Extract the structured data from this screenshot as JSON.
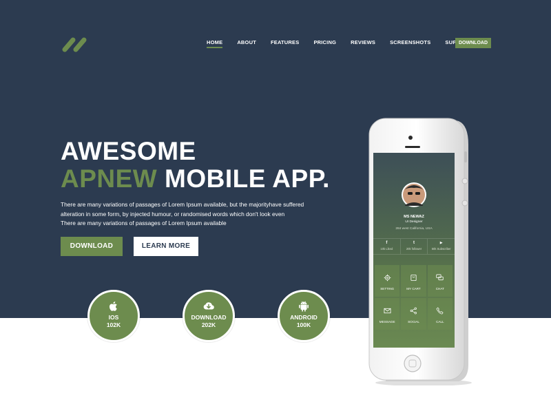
{
  "nav": {
    "items": [
      {
        "label": "HOME",
        "active": true
      },
      {
        "label": "ABOUT"
      },
      {
        "label": "FEATURES"
      },
      {
        "label": "PRICING"
      },
      {
        "label": "REVIEWS"
      },
      {
        "label": "SCREENSHOTS"
      },
      {
        "label": "SUPPORT"
      }
    ],
    "download_label": "DOWNLOAD"
  },
  "hero": {
    "line1": "AWESOME",
    "line2_accent": "APNEW",
    "line2_rest": " MOBILE APP.",
    "desc": [
      "There are many variations of passages of Lorem Ipsum available, but the majorityhave suffered",
      "alteration in some form, by injected humour, or randomised words which don't look even",
      "There are many variations of passages of Lorem Ipsum available"
    ],
    "download_button": "DOWNLOAD",
    "learn_more_button": "LEARN MORE"
  },
  "stats": [
    {
      "label": "IOS",
      "value": "102K",
      "icon": "apple-icon"
    },
    {
      "label": "DOWNLOAD",
      "value": "202K",
      "icon": "cloud-download-icon"
    },
    {
      "label": "ANDROID",
      "value": "100K",
      "icon": "android-icon"
    }
  ],
  "phone": {
    "profile": {
      "name": "MS NEWAZ",
      "role": "UI Designer",
      "location": "284 west California, USA"
    },
    "social": [
      {
        "icon": "facebook-icon",
        "glyph": "f",
        "label": "10k Liked"
      },
      {
        "icon": "twitter-icon",
        "glyph": "t",
        "label": "20k follower"
      },
      {
        "icon": "youtube-icon",
        "glyph": "▶",
        "label": "50k Subscriber"
      }
    ],
    "tiles": [
      {
        "icon": "gear-icon",
        "label": "SETTING"
      },
      {
        "icon": "cart-icon",
        "label": "MY CART"
      },
      {
        "icon": "chat-icon",
        "label": "CHAT"
      },
      {
        "icon": "message-icon",
        "label": "MESSAGE"
      },
      {
        "icon": "share-icon",
        "label": "SOCIAL"
      },
      {
        "icon": "phone-icon",
        "label": "CALL"
      }
    ]
  },
  "colors": {
    "hero_bg": "#2c3b50",
    "accent": "#6d8c4e",
    "white": "#ffffff"
  }
}
